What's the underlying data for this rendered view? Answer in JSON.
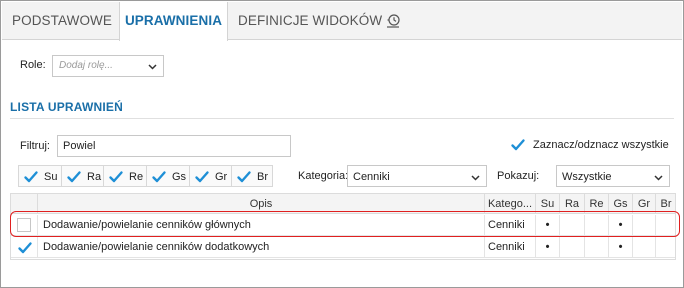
{
  "tabs": [
    {
      "label": "PODSTAWOWE",
      "active": false
    },
    {
      "label": "UPRAWNIENIA",
      "active": true
    },
    {
      "label": "DEFINICJE WIDOKÓW",
      "active": false
    }
  ],
  "role": {
    "label": "Role:",
    "placeholder": "Dodaj rolę..."
  },
  "section_title": "LISTA UPRAWNIEŃ",
  "filter": {
    "label": "Filtruj:",
    "value": "Powiel"
  },
  "select_all": {
    "label": "Zaznacz/odznacz wszystkie",
    "checked": true
  },
  "permissions": [
    {
      "label": "Su",
      "checked": true
    },
    {
      "label": "Ra",
      "checked": true
    },
    {
      "label": "Re",
      "checked": true
    },
    {
      "label": "Gs",
      "checked": true
    },
    {
      "label": "Gr",
      "checked": true
    },
    {
      "label": "Br",
      "checked": true
    }
  ],
  "category": {
    "label": "Kategoria:",
    "value": "Cenniki"
  },
  "show": {
    "label": "Pokazuj:",
    "value": "Wszystkie"
  },
  "table": {
    "columns": [
      "Opis",
      "Katego...",
      "Su",
      "Ra",
      "Re",
      "Gs",
      "Gr",
      "Br"
    ],
    "rows": [
      {
        "checked": false,
        "opis": "Dodawanie/powielanie cenników głównych",
        "kategoria": "Cenniki",
        "su": "•",
        "ra": "",
        "re": "",
        "gs": "•",
        "gr": "",
        "br": ""
      },
      {
        "checked": true,
        "opis": "Dodawanie/powielanie cenników dodatkowych",
        "kategoria": "Cenniki",
        "su": "•",
        "ra": "",
        "re": "",
        "gs": "•",
        "gr": "",
        "br": ""
      }
    ]
  },
  "colors": {
    "accent": "#1a6fa8",
    "check": "#1e8fd6",
    "highlight": "#e02020"
  },
  "icons": {
    "history": "history-icon",
    "chevron": "chevron-down-icon",
    "check": "check-icon"
  }
}
